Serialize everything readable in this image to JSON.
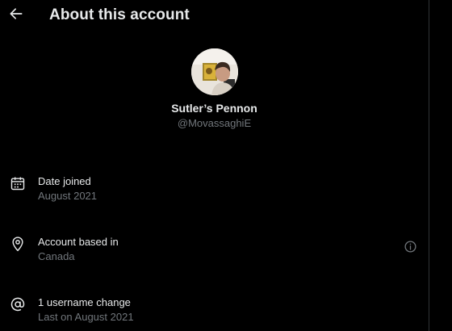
{
  "header": {
    "title": "About this account",
    "back_icon": "arrow-left-icon"
  },
  "profile": {
    "display_name": "Sutler’s Pennon",
    "handle": "@MovassaghiE"
  },
  "details": [
    {
      "icon": "calendar-icon",
      "label": "Date joined",
      "value": "August 2021"
    },
    {
      "icon": "location-pin-icon",
      "label": "Account based in",
      "value": "Canada",
      "help_icon": "info-circle-icon"
    },
    {
      "icon": "at-sign-icon",
      "label": "1 username change",
      "value": "Last on August 2021"
    }
  ],
  "colors": {
    "background": "#000000",
    "primary_text": "#e7e9ea",
    "secondary_text": "#71767b",
    "divider": "#2f3336"
  }
}
